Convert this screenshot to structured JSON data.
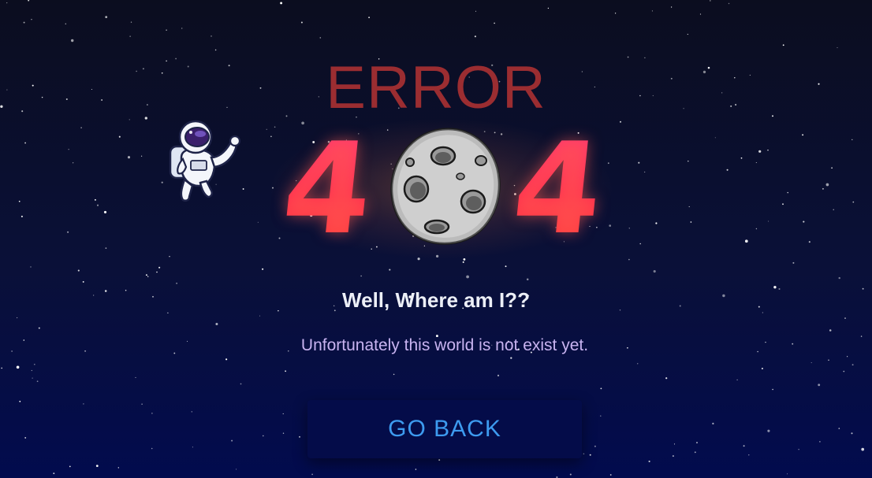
{
  "error": {
    "title": "ERROR",
    "code_left": "4",
    "code_right": "4",
    "code_middle_icon": "moon-icon"
  },
  "astronaut_icon": "astronaut-icon",
  "subtitle": "Well, Where am I??",
  "message": "Unfortunately this world is not exist yet.",
  "button": {
    "label": "GO BACK"
  },
  "colors": {
    "background_top": "#0b0d1f",
    "background_bottom": "#020b4e",
    "error_title": "#9b2d31",
    "digit_pink": "#ff3b7a",
    "digit_red": "#ff2e4f",
    "subtitle": "#eceff7",
    "message": "#c8b3f0",
    "button_bg": "#040c49",
    "button_text": "#3d9bf0"
  }
}
